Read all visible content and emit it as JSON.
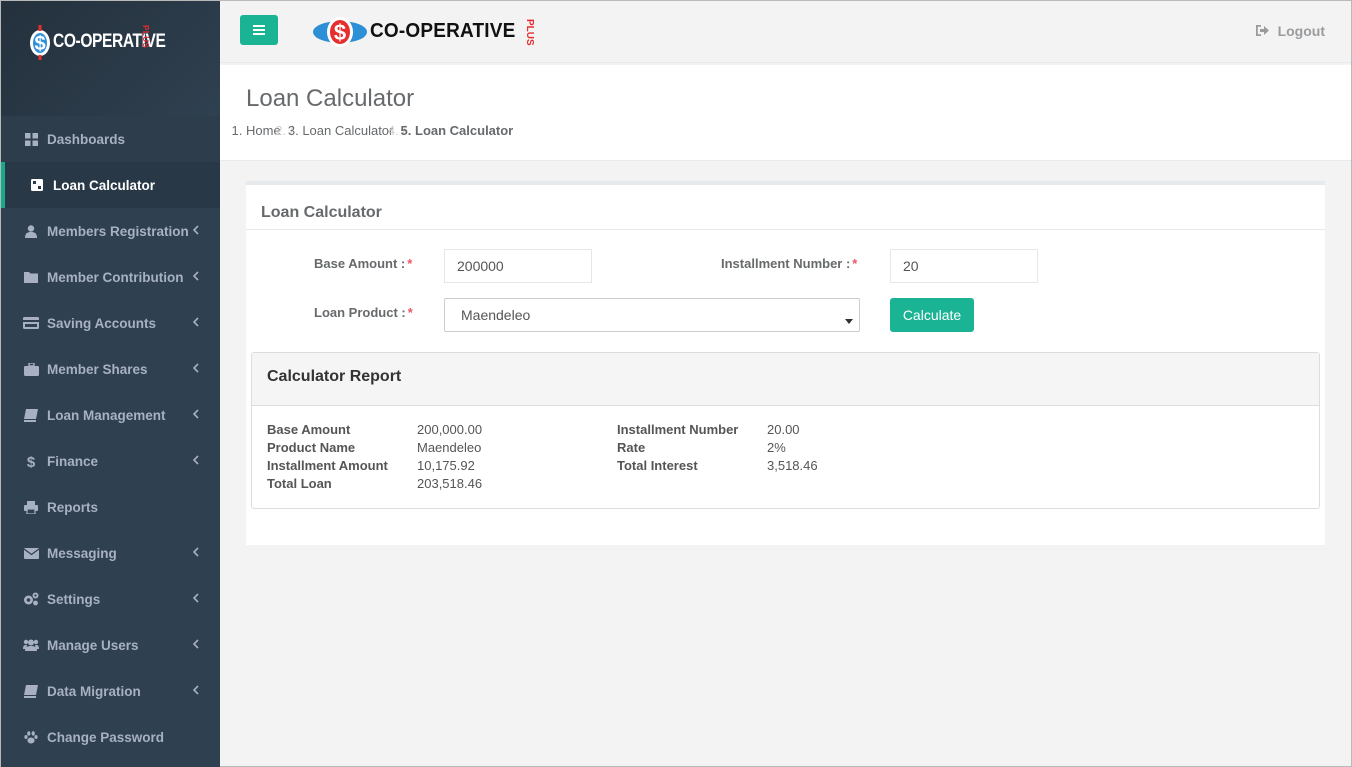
{
  "brand": {
    "name": "CO-OPERATIVE",
    "plus": "PLUS"
  },
  "sidebar": {
    "items": [
      {
        "label": "Dashboards",
        "icon": "grid-icon",
        "has_children": false
      },
      {
        "label": "Loan Calculator",
        "icon": "calculator-icon",
        "has_children": false,
        "active": true
      },
      {
        "label": "Members Registration",
        "icon": "user-icon",
        "has_children": true
      },
      {
        "label": "Member Contribution",
        "icon": "folder-icon",
        "has_children": true
      },
      {
        "label": "Saving Accounts",
        "icon": "credit-card-icon",
        "has_children": true
      },
      {
        "label": "Member Shares",
        "icon": "briefcase-icon",
        "has_children": true
      },
      {
        "label": "Loan Management",
        "icon": "book-icon",
        "has_children": true
      },
      {
        "label": "Finance",
        "icon": "dollar-icon",
        "has_children": true
      },
      {
        "label": "Reports",
        "icon": "print-icon",
        "has_children": false
      },
      {
        "label": "Messaging",
        "icon": "envelope-icon",
        "has_children": true
      },
      {
        "label": "Settings",
        "icon": "cogs-icon",
        "has_children": true
      },
      {
        "label": "Manage Users",
        "icon": "users-icon",
        "has_children": true
      },
      {
        "label": "Data Migration",
        "icon": "book-icon",
        "has_children": true
      },
      {
        "label": "Change Password",
        "icon": "paw-icon",
        "has_children": false
      }
    ]
  },
  "topbar": {
    "logout_label": "Logout"
  },
  "page": {
    "title": "Loan Calculator",
    "breadcrumb": [
      "Home",
      "Loan Calculator",
      "Loan Calculator"
    ]
  },
  "form": {
    "title": "Loan Calculator",
    "base_amount_label": "Base Amount :",
    "base_amount_value": "200000",
    "installment_label": "Installment Number :",
    "installment_value": "20",
    "loan_product_label": "Loan Product :",
    "loan_product_value": "Maendeleo",
    "required_mark": "*",
    "calculate_label": "Calculate"
  },
  "report": {
    "title": "Calculator Report",
    "left": [
      {
        "label": "Base Amount",
        "value": "200,000.00"
      },
      {
        "label": "Product Name",
        "value": "Maendeleo"
      },
      {
        "label": "Installment Amount",
        "value": "10,175.92"
      },
      {
        "label": "Total Loan",
        "value": "203,518.46"
      }
    ],
    "right": [
      {
        "label": "Installment Number",
        "value": "20.00"
      },
      {
        "label": "Rate",
        "value": "2%"
      },
      {
        "label": "Total Interest",
        "value": "3,518.46"
      }
    ]
  },
  "colors": {
    "sidebar_bg": "#2f4050",
    "accent": "#1ab394",
    "required": "#ed5565",
    "brand_red": "#e62e2e"
  }
}
